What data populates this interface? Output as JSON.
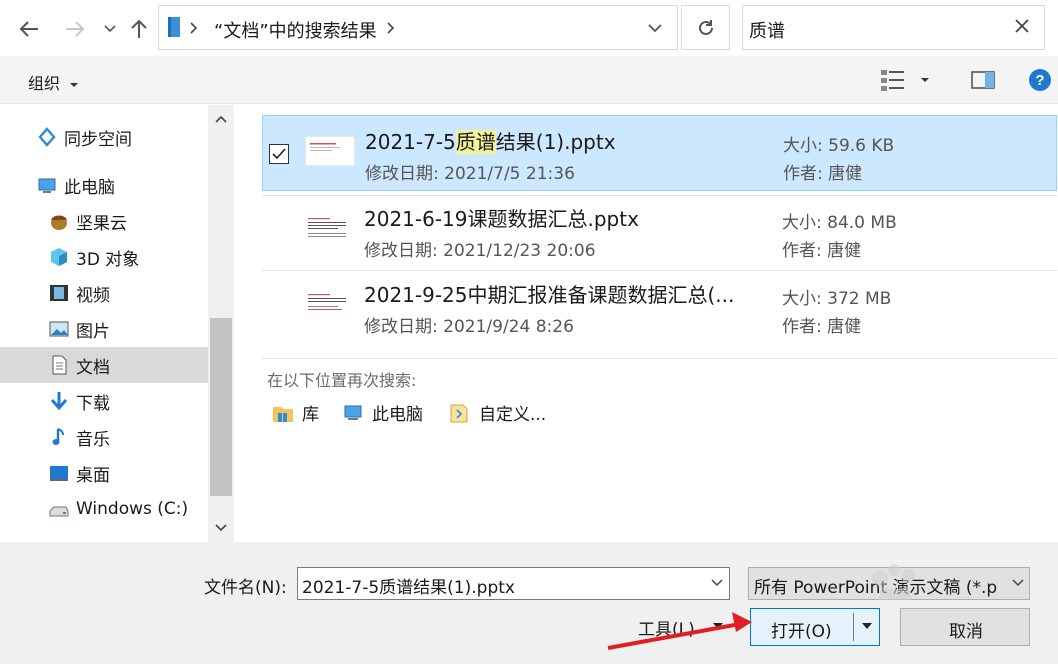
{
  "nav": {
    "address_path": "“文档”中的搜索结果",
    "search_value": "质谱"
  },
  "toolbar": {
    "organize_label": "组织"
  },
  "sidebar": {
    "items": [
      {
        "label": "同步空间",
        "icon": "sync-space-icon"
      },
      {
        "label": "此电脑",
        "icon": "computer-icon"
      },
      {
        "label": "坚果云",
        "icon": "nut-cloud-icon"
      },
      {
        "label": "3D 对象",
        "icon": "3d-objects-icon"
      },
      {
        "label": "视频",
        "icon": "video-icon"
      },
      {
        "label": "图片",
        "icon": "picture-icon"
      },
      {
        "label": "文档",
        "icon": "document-icon",
        "selected": true
      },
      {
        "label": "下载",
        "icon": "download-icon"
      },
      {
        "label": "音乐",
        "icon": "music-icon"
      },
      {
        "label": "桌面",
        "icon": "desktop-icon"
      },
      {
        "label": "Windows (C:)",
        "icon": "drive-icon"
      }
    ]
  },
  "files": [
    {
      "name_prefix": "2021-7-5",
      "name_highlight": "质谱",
      "name_suffix": "结果(1).pptx",
      "date_label": "修改日期:",
      "date": "2021/7/5 21:36",
      "size_label": "大小:",
      "size": "59.6 KB",
      "author_label": "作者:",
      "author": "唐健",
      "selected": true
    },
    {
      "name_prefix": "2021-6-19课题数据汇总.pptx",
      "name_highlight": "",
      "name_suffix": "",
      "date_label": "修改日期:",
      "date": "2021/12/23 20:06",
      "size_label": "大小:",
      "size": "84.0 MB",
      "author_label": "作者:",
      "author": "唐健",
      "selected": false
    },
    {
      "name_prefix": "2021-9-25中期汇报准备课题数据汇总(...",
      "name_highlight": "",
      "name_suffix": "",
      "date_label": "修改日期:",
      "date": "2021/9/24 8:26",
      "size_label": "大小:",
      "size": "372 MB",
      "author_label": "作者:",
      "author": "唐健",
      "selected": false
    }
  ],
  "search_again": {
    "label": "在以下位置再次搜索:",
    "locations": [
      "库",
      "此电脑",
      "自定义..."
    ]
  },
  "footer": {
    "filename_label": "文件名(N):",
    "filename_value": "2021-7-5质谱结果(1).pptx",
    "filter_value": "所有 PowerPoint 演示文稿 (*.p",
    "tools_label": "工具(L)",
    "open_label": "打开(O)",
    "cancel_label": "取消"
  },
  "colors": {
    "selection_bg": "#cce8ff",
    "selection_border": "#99d1ff",
    "highlight": "#f4f39b",
    "accent": "#0078d7",
    "arrow": "#e02020"
  }
}
